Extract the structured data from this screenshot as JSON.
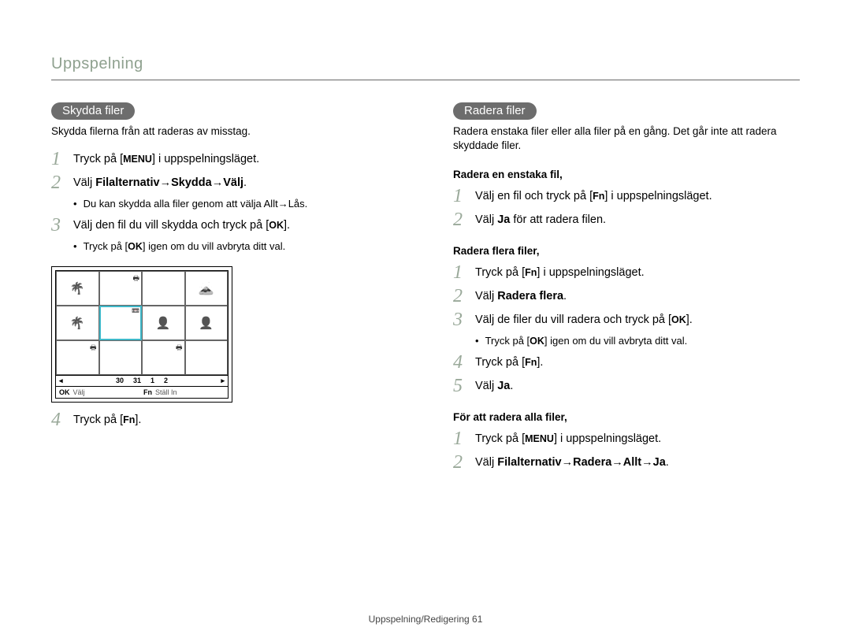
{
  "header": {
    "title": "Uppspelning"
  },
  "left": {
    "pill": "Skydda filer",
    "intro": "Skydda filerna från att raderas av misstag.",
    "s1": {
      "pre": "Tryck på [",
      "key": "MENU",
      "post": "] i uppspelningsläget."
    },
    "s2": {
      "pre": "Välj ",
      "b1": "Filalternativ",
      "arrow1": " → ",
      "b2": "Skydda",
      "arrow2": " → ",
      "b3": "Välj",
      "post": "."
    },
    "s2_bullet": {
      "pre": "Du kan skydda alla filer genom att välja ",
      "b1": "Allt",
      "arrow": " → ",
      "b2": "Lås",
      "post": "."
    },
    "s3": {
      "pre": "Välj den fil du vill skydda och tryck på [",
      "key": "OK",
      "post": "]."
    },
    "s3_bullet": {
      "pre": "Tryck på [",
      "key": "OK",
      "post": "] igen om du vill avbryta ditt val."
    },
    "s4": {
      "pre": "Tryck på [",
      "key": "Fn",
      "post": "]."
    },
    "shot": {
      "film": {
        "left_tri": "◂",
        "n1": "30",
        "n2": "31",
        "n3": "1",
        "n4": "2",
        "right_tri": "▸"
      },
      "bottom": {
        "k1": "OK",
        "l1": "Välj",
        "k2": "Fn",
        "l2": "Ställ In"
      }
    }
  },
  "right": {
    "pill": "Radera filer",
    "intro": "Radera enstaka filer eller alla filer på en gång. Det går inte att radera skyddade filer.",
    "h1": "Radera en enstaka fil,",
    "a1": {
      "pre": "Välj en fil och tryck på [",
      "key": "Fn",
      "post": "] i uppspelningsläget."
    },
    "a2": {
      "pre": "Välj ",
      "b": "Ja",
      "post": " för att radera filen."
    },
    "h2": "Radera flera filer,",
    "b1": {
      "pre": "Tryck på [",
      "key": "Fn",
      "post": "] i uppspelningsläget."
    },
    "b2": {
      "pre": "Välj ",
      "b": "Radera flera",
      "post": "."
    },
    "b3": {
      "pre": "Välj de filer du vill radera och tryck på [",
      "key": "OK",
      "post": "]."
    },
    "b3_bullet": {
      "pre": "Tryck på [",
      "key": "OK",
      "post": "] igen om du vill avbryta ditt val."
    },
    "b4": {
      "pre": "Tryck på [",
      "key": "Fn",
      "post": "]."
    },
    "b5": {
      "pre": "Välj ",
      "b": "Ja",
      "post": "."
    },
    "h3": "För att radera alla filer,",
    "c1": {
      "pre": "Tryck på [",
      "key": "MENU",
      "post": "] i uppspelningsläget."
    },
    "c2": {
      "pre": "Välj ",
      "b1": "Filalternativ",
      "a1": " → ",
      "b2": "Radera",
      "a2": " → ",
      "b3": "Allt",
      "a3": " → ",
      "b4": "Ja",
      "post": "."
    }
  },
  "footer": {
    "text": "Uppspelning/Redigering  61"
  }
}
